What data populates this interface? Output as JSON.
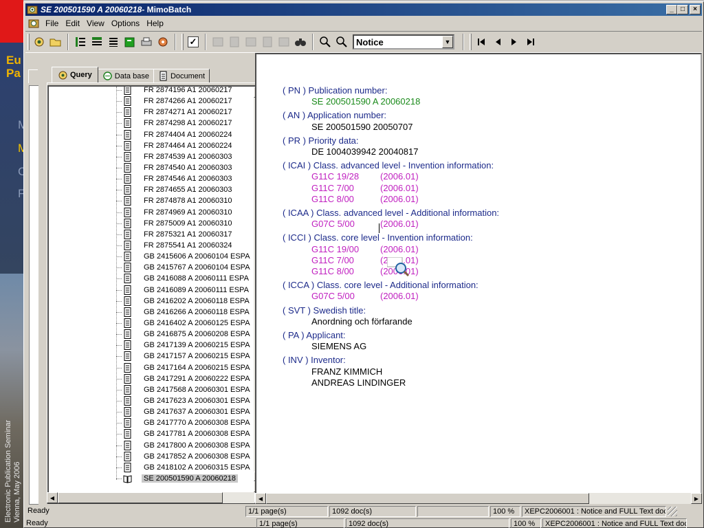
{
  "background": {
    "title_line1": "Eu",
    "title_line2": "Pa",
    "menu": [
      "M",
      "M",
      "C",
      "F"
    ],
    "vertical_line1": "Electronic Publication Seminar",
    "vertical_line2": "Vienna, May 2006"
  },
  "window": {
    "title_doc": "SE 200501590 A 20060218",
    "title_app": " - MimoBatch",
    "buttons": {
      "minimize": "_",
      "maximize": "□",
      "close": "×"
    }
  },
  "menu": [
    "File",
    "Edit",
    "View",
    "Options",
    "Help"
  ],
  "toolbar": {
    "checkbox_checked": "✓",
    "view_select": "Notice",
    "nav_first": "⏮",
    "nav_prev": "◀",
    "nav_next": "▶",
    "nav_last": "⏭"
  },
  "tabs": [
    {
      "label": "Query",
      "active": true
    },
    {
      "label": "Data base",
      "active": false
    },
    {
      "label": "Document",
      "active": false
    }
  ],
  "tree": [
    "FR 2874196 A1   20060217",
    "FR 2874266 A1   20060217",
    "FR 2874271 A1   20060217",
    "FR 2874298 A1   20060217",
    "FR 2874404 A1   20060224",
    "FR 2874464 A1   20060224",
    "FR 2874539 A1   20060303",
    "FR 2874540 A1   20060303",
    "FR 2874546 A1   20060303",
    "FR 2874655 A1   20060303",
    "FR 2874878 A1   20060310",
    "FR 2874969 A1   20060310",
    "FR 2875009 A1   20060310",
    "FR 2875321 A1   20060317",
    "FR 2875541 A1   20060324",
    "GB 2415606 A   20060104   ESPA",
    "GB 2415767 A   20060104   ESPA",
    "GB 2416088 A   20060111   ESPA",
    "GB 2416089 A   20060111   ESPA",
    "GB 2416202 A   20060118   ESPA",
    "GB 2416266 A   20060118   ESPA",
    "GB 2416402 A   20060125   ESPA",
    "GB 2416875 A   20060208   ESPA",
    "GB 2417139 A   20060215   ESPA",
    "GB 2417157 A   20060215   ESPA",
    "GB 2417164 A   20060215   ESPA",
    "GB 2417291 A   20060222   ESPA",
    "GB 2417568 A   20060301   ESPA",
    "GB 2417623 A   20060301   ESPA",
    "GB 2417637 A   20060301   ESPA",
    "GB 2417770 A   20060308   ESPA",
    "GB 2417781 A   20060308   ESPA",
    "GB 2417800 A   20060308   ESPA",
    "GB 2417852 A   20060308   ESPA",
    "GB 2418102 A   20060315   ESPA",
    "SE 200501590 A   20060218"
  ],
  "selected_index": 35,
  "document": {
    "pn_label": "( PN ) Publication number:",
    "pn_value": "SE 200501590 A 20060218",
    "an_label": "( AN ) Application number:",
    "an_value": "SE 200501590 20050707",
    "pr_label": "( PR ) Priority data:",
    "pr_value": "DE 1004039942 20040817",
    "icai_label": "( ICAI ) Class. advanced level - Invention information:",
    "icai_values": [
      {
        "code": "G11C  19/28",
        "ver": "(2006.01)"
      },
      {
        "code": "G11C  7/00",
        "ver": "(2006.01)"
      },
      {
        "code": "G11C  8/00",
        "ver": "(2006.01)"
      }
    ],
    "icaa_label": "( ICAA ) Class. advanced level - Additional information:",
    "icaa_values": [
      {
        "code": "G07C  5/00",
        "ver": "(2006.01)"
      }
    ],
    "icci_label": "( ICCI ) Class. core level - Invention information:",
    "icci_values": [
      {
        "code": "G11C  19/00",
        "ver": "(2006.01)"
      },
      {
        "code": "G11C  7/00",
        "ver": "(2006.01)"
      },
      {
        "code": "G11C  8/00",
        "ver": "(2006.01)"
      }
    ],
    "icca_label": "( ICCA ) Class. core level - Additional information:",
    "icca_values": [
      {
        "code": "G07C  5/00",
        "ver": "(2006.01)"
      }
    ],
    "svt_label": "( SVT ) Swedish title:",
    "svt_value": "Anordning och förfarande",
    "pa_label": "( PA ) Applicant:",
    "pa_value": "SIEMENS AG",
    "inv_label": "( INV ) Inventor:",
    "inv_values": [
      "FRANZ KIMMICH",
      "ANDREAS LINDINGER"
    ]
  },
  "status": {
    "ready": "Ready",
    "pages": "1/1 page(s)",
    "docs": "1092 doc(s)",
    "zoom": "100 %",
    "info": "XEPC2006001 : Notice and FULL Text doc"
  },
  "colors": {
    "label": "#1c2a8a",
    "pn_value": "#1a8a1a",
    "classification": "#c020c0",
    "titlebar": "#0a246a"
  }
}
